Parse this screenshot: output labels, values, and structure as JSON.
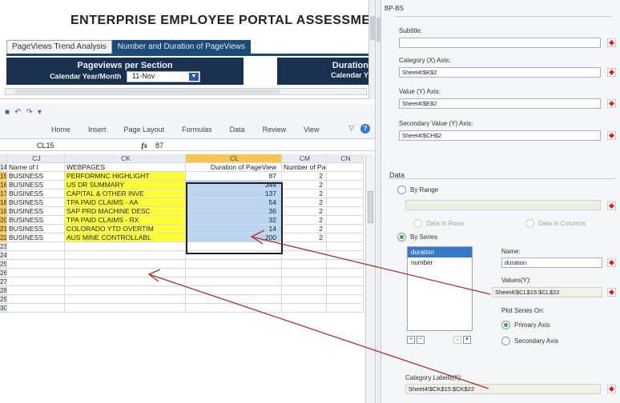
{
  "preview": {
    "title": "ENTERPRISE EMPLOYEE PORTAL ASSESSME",
    "tabs": [
      "PageViews Trend Analysis",
      "Number and Duration of PageViews"
    ],
    "left_panel_title": "Pageviews per Section",
    "left_panel_label": "Calendar Year/Month",
    "month_value": "11-Nov",
    "right_panel_title": "Duration",
    "right_panel_label": "Calendar Y"
  },
  "ribbon": {
    "tabs": [
      "Home",
      "Insert",
      "Page Layout",
      "Formulas",
      "Data",
      "Review",
      "View"
    ]
  },
  "formula_bar": {
    "name_box": "CL15",
    "fx": "fx",
    "value": "87"
  },
  "sheet": {
    "columns": [
      "CJ",
      "CK",
      "CL",
      "CM",
      "CN"
    ],
    "rows": [
      {
        "num": "14",
        "cj": "Name of t",
        "ck": "WEBPAGES",
        "cl": "Duration of PageView",
        "cm": "Number of PageVi",
        "cn": ""
      },
      {
        "num": "15",
        "cj": "BUSINESS",
        "ck": "PERFORMNC HIGHLIGHT",
        "cl": "87",
        "cm": "2",
        "cn": ""
      },
      {
        "num": "16",
        "cj": "BUSINESS",
        "ck": "US DR SUMMARY",
        "cl": "344",
        "cm": "2",
        "cn": ""
      },
      {
        "num": "17",
        "cj": "BUSINESS",
        "ck": "CAPITAL & OTHER INVE",
        "cl": "137",
        "cm": "2",
        "cn": ""
      },
      {
        "num": "18",
        "cj": "BUSINESS",
        "ck": "TPA PAID CLAIMS - AA",
        "cl": "54",
        "cm": "2",
        "cn": ""
      },
      {
        "num": "19",
        "cj": "BUSINESS",
        "ck": "SAP PRD MACHINE DESC",
        "cl": "36",
        "cm": "2",
        "cn": ""
      },
      {
        "num": "20",
        "cj": "BUSINESS",
        "ck": "TPA PAID CLAIMS - RX",
        "cl": "32",
        "cm": "2",
        "cn": ""
      },
      {
        "num": "21",
        "cj": "BUSINESS",
        "ck": "COLORADO YTD OVERTIM",
        "cl": "14",
        "cm": "2",
        "cn": ""
      },
      {
        "num": "22",
        "cj": "BUSINESS",
        "ck": "AUS MINE CONTROLLABL",
        "cl": "200",
        "cm": "2",
        "cn": ""
      },
      {
        "num": "23",
        "cj": "",
        "ck": "",
        "cl": "",
        "cm": "",
        "cn": ""
      },
      {
        "num": "24",
        "cj": "",
        "ck": "",
        "cl": "",
        "cm": "",
        "cn": ""
      },
      {
        "num": "25",
        "cj": "",
        "ck": "",
        "cl": "",
        "cm": "",
        "cn": ""
      },
      {
        "num": "26",
        "cj": "",
        "ck": "",
        "cl": "",
        "cm": "",
        "cn": ""
      },
      {
        "num": "27",
        "cj": "",
        "ck": "",
        "cl": "",
        "cm": "",
        "cn": ""
      },
      {
        "num": "28",
        "cj": "",
        "ck": "",
        "cl": "",
        "cm": "",
        "cn": ""
      },
      {
        "num": "29",
        "cj": "",
        "ck": "",
        "cl": "",
        "cm": "",
        "cn": ""
      },
      {
        "num": "30",
        "cj": "",
        "ck": "",
        "cl": "",
        "cm": "",
        "cn": ""
      }
    ]
  },
  "dialog": {
    "title": "BP-BS",
    "subtitle_label": "Subtitle:",
    "subtitle_value": "",
    "category_label": "Category (X) Axis:",
    "category_value": "Sheet4!$K$2",
    "value_label": "Value (Y) Axis:",
    "value_value": "Sheet4!$E$2",
    "secondary_label": "Secondary Value (Y) Axis:",
    "secondary_value": "Sheet4!$CH$2",
    "data_section": "Data",
    "by_range": "By Range",
    "data_in_rows": "Data in Rows",
    "data_in_columns": "Data in Columns",
    "by_series": "By Series",
    "series": [
      "duration",
      "number"
    ],
    "name_label": "Name:",
    "name_value": "duration",
    "values_label": "Values(Y):",
    "values_value": "Sheet4!$CL$15:$CL$22",
    "plot_on_label": "Plot Series On:",
    "primary_axis": "Primary Axis",
    "secondary_axis": "Secondary Axis",
    "category_labels_label": "Category Labels(X):",
    "category_labels_value": "Sheet4!$CK$15:$CK$22"
  },
  "colors": {
    "highlight_yellow": "#ffff36",
    "selection_blue": "#b9d5f2",
    "panel_navy": "#19314f",
    "arrow_red": "#b0302a"
  }
}
